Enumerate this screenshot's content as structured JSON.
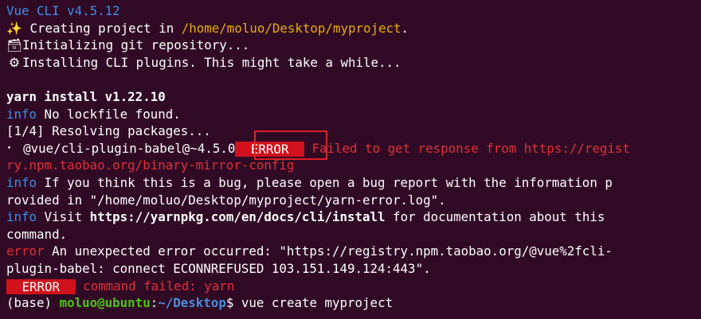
{
  "header": {
    "title": "Vue CLI v4.5.12"
  },
  "steps": [
    {
      "icon": "sparkles-icon",
      "glyph": "✨",
      "text": " Creating project in ",
      "path": "/home/moluo/Desktop/myproject",
      "suffix": "."
    },
    {
      "icon": "floppy-icon",
      "glyph": "🗃",
      "text": "Initializing git repository..."
    },
    {
      "icon": "gear-icon",
      "glyph": "⚙",
      "text": "Installing CLI plugins. This might take a while..."
    }
  ],
  "yarn": {
    "version_line": "yarn install v1.22.10",
    "info1_tag": "info",
    "info1_text": " No lockfile found.",
    "resolving": "[1/4] Resolving packages...",
    "pkg_prefix": "⠂ @vue/cli-plugin-babel@~4.5.0",
    "error_badge": " ERROR ",
    "error_msg_1": " Failed to get response from https://regist",
    "error_msg_2": "ry.npm.taobao.org/binary-mirror-config",
    "info2_tag": "info",
    "info2_text_1": " If you think this is a bug, please open a bug report with the information p",
    "info2_text_2": "rovided in \"/home/moluo/Desktop/myproject/yarn-error.log\".",
    "info3_tag": "info",
    "info3_pre": " Visit ",
    "info3_url": "https://yarnpkg.com/en/docs/cli/install",
    "info3_post": " for documentation about this",
    "info3_cont": "command.",
    "error_tag": "error",
    "error_text_1": " An unexpected error occurred: \"https://registry.npm.taobao.org/@vue%2fcli-",
    "error_text_2": "plugin-babel: connect ECONNREFUSED 103.151.149.124:443\"."
  },
  "final": {
    "error_badge": " ERROR ",
    "message": " command failed: yarn"
  },
  "prompt": {
    "env": "(base) ",
    "user_host": "moluo@ubuntu",
    "colon": ":",
    "cwd": "~/Desktop",
    "dollar": "$ ",
    "command": "vue create myproject"
  },
  "colors": {
    "background": "#300a24",
    "info_blue": "#3b8eea",
    "error_red": "#e0303a",
    "path_yellow": "#e9ad0c",
    "prompt_green": "#4fc414"
  }
}
